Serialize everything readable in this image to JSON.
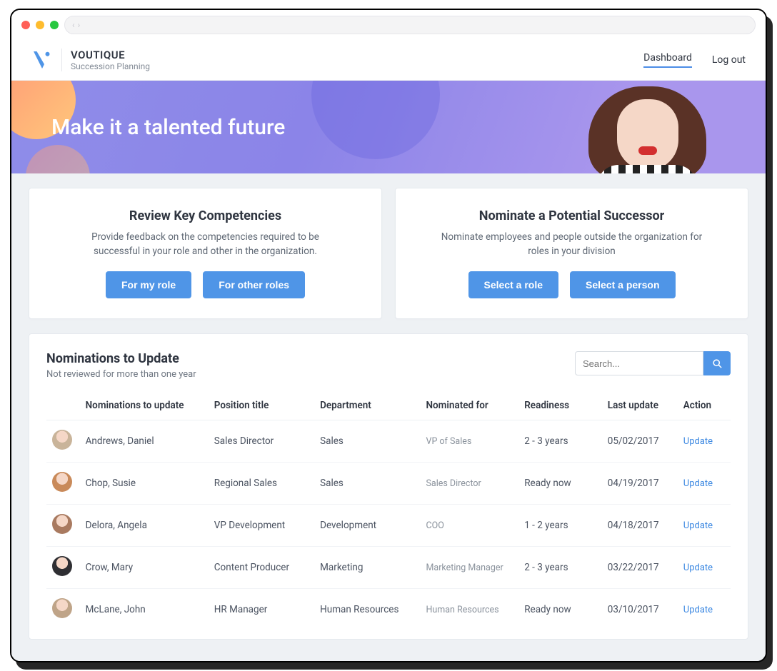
{
  "brand": {
    "title": "VOUTIQUE",
    "subtitle": "Succession Planning"
  },
  "nav": {
    "dashboard": "Dashboard",
    "logout": "Log out"
  },
  "hero": {
    "headline": "Make it a talented future"
  },
  "cards": {
    "left": {
      "title": "Review Key Competencies",
      "body": "Provide feedback on the competencies required to be successful in your role and other in the organization.",
      "btn1": "For my role",
      "btn2": "For other roles"
    },
    "right": {
      "title": "Nominate a Potential Successor",
      "body": "Nominate employees and people outside the organization for roles in your division",
      "btn1": "Select a role",
      "btn2": "Select a person"
    }
  },
  "panel": {
    "title": "Nominations to Update",
    "subtitle": "Not reviewed for more than one year",
    "search_placeholder": "Search..."
  },
  "table": {
    "headers": {
      "name": "Nominations to update",
      "position": "Position title",
      "department": "Department",
      "nominated_for": "Nominated for",
      "readiness": "Readiness",
      "last_update": "Last update",
      "action": "Action"
    },
    "action_label": "Update",
    "rows": [
      {
        "avatar": "#c9b49a",
        "name": "Andrews, Daniel",
        "position": "Sales Director",
        "department": "Sales",
        "nominated_for": "VP of Sales",
        "readiness": "2 - 3 years",
        "last_update": "05/02/2017"
      },
      {
        "avatar": "#c98a5a",
        "name": "Chop, Susie",
        "position": "Regional Sales",
        "department": "Sales",
        "nominated_for": "Sales Director",
        "readiness": "Ready now",
        "last_update": "04/19/2017"
      },
      {
        "avatar": "#a97a60",
        "name": "Delora, Angela",
        "position": "VP Development",
        "department": "Development",
        "nominated_for": "COO",
        "readiness": "1 - 2 years",
        "last_update": "04/18/2017"
      },
      {
        "avatar": "#2f2f33",
        "name": "Crow, Mary",
        "position": "Content Producer",
        "department": "Marketing",
        "nominated_for": "Marketing Manager",
        "readiness": "2 - 3 years",
        "last_update": "03/22/2017"
      },
      {
        "avatar": "#bfa488",
        "name": "McLane, John",
        "position": "HR Manager",
        "department": "Human Resources",
        "nominated_for": "Human Resources",
        "readiness": "Ready now",
        "last_update": "03/10/2017"
      }
    ]
  }
}
